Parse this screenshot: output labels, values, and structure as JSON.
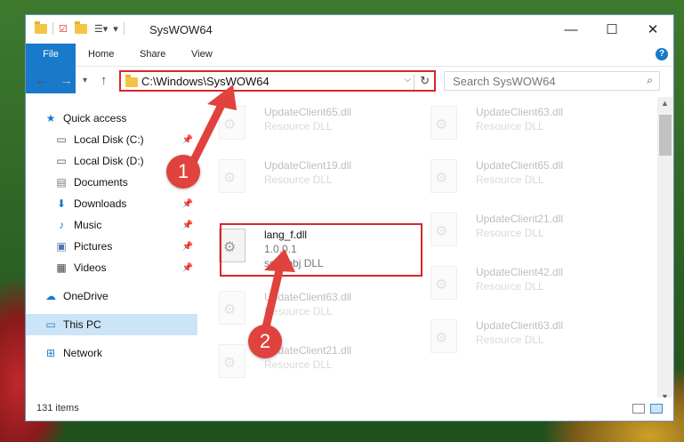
{
  "window": {
    "title": "SysWOW64"
  },
  "ribbon": {
    "tabs": [
      "File",
      "Home",
      "Share",
      "View"
    ],
    "help": "?"
  },
  "address": {
    "path": "C:\\Windows\\SysWOW64"
  },
  "search": {
    "placeholder": "Search SysWOW64"
  },
  "sidebar": {
    "items": [
      {
        "label": "Quick access",
        "icon": "star-icon"
      },
      {
        "label": "Local Disk (C:)",
        "icon": "drive-icon"
      },
      {
        "label": "Local Disk (D:)",
        "icon": "drive-icon"
      },
      {
        "label": "Documents",
        "icon": "documents-icon"
      },
      {
        "label": "Downloads",
        "icon": "download-icon"
      },
      {
        "label": "Music",
        "icon": "music-icon"
      },
      {
        "label": "Pictures",
        "icon": "pictures-icon"
      },
      {
        "label": "Videos",
        "icon": "videos-icon"
      },
      {
        "label": "OneDrive",
        "icon": "cloud-icon"
      },
      {
        "label": "This PC",
        "icon": "computer-icon"
      },
      {
        "label": "Network",
        "icon": "network-icon"
      }
    ]
  },
  "files": {
    "col1": [
      {
        "name": "UpdateClient65.dll",
        "type": "Resource DLL"
      },
      {
        "name": "UpdateClient19.dll",
        "type": "Resource DLL"
      },
      {
        "name": "UpdateClient63.dll",
        "type": "Resource DLL"
      },
      {
        "name": "UpdateClient21.dll",
        "type": "Resource DLL"
      }
    ],
    "col2": [
      {
        "name": "UpdateClient63.dll",
        "type": "Resource DLL"
      },
      {
        "name": "UpdateClient65.dll",
        "type": "Resource DLL"
      },
      {
        "name": "UpdateClient21.dll",
        "type": "Resource DLL"
      },
      {
        "name": "UpdateClient42.dll",
        "type": "Resource DLL"
      },
      {
        "name": "UpdateClient63.dll",
        "type": "Resource DLL"
      }
    ],
    "highlighted": {
      "name": "lang_f.dll",
      "version": "1.0.0.1",
      "type": "scanobj DLL"
    }
  },
  "status": {
    "count": "131 items"
  },
  "annotations": {
    "step1": "1",
    "step2": "2",
    "color": "#d9262c"
  }
}
